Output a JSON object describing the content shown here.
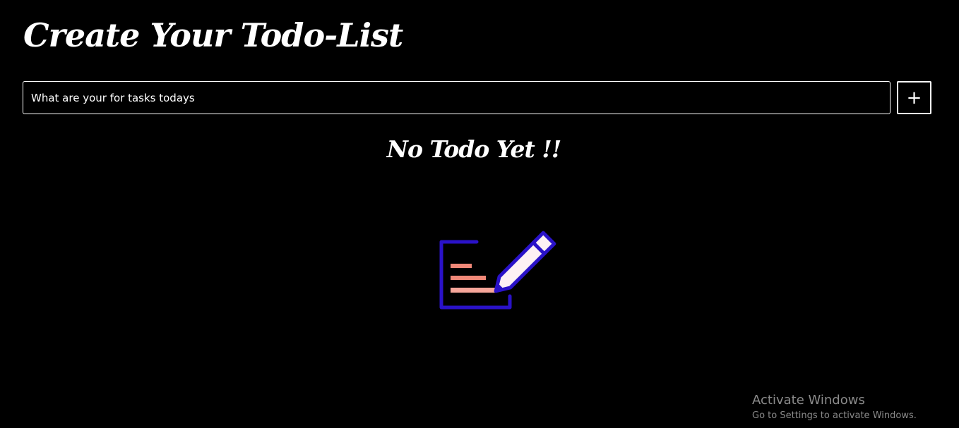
{
  "header": {
    "title": "Create Your Todo-List"
  },
  "task_form": {
    "input_value": "What are your for tasks todays",
    "add_label": "+"
  },
  "empty_state": {
    "message": "No Todo Yet !!",
    "illustration": "note-with-pencil-icon"
  },
  "os_watermark": {
    "title": "Activate Windows",
    "subtitle": "Go to Settings to activate Windows."
  },
  "colors": {
    "background": "#000000",
    "text": "#ffffff",
    "illustration_outline": "#2a12c8",
    "illustration_lines": "#f08878",
    "illustration_pencil_fill": "#fdf1f4",
    "watermark": "#8a8a8a"
  }
}
